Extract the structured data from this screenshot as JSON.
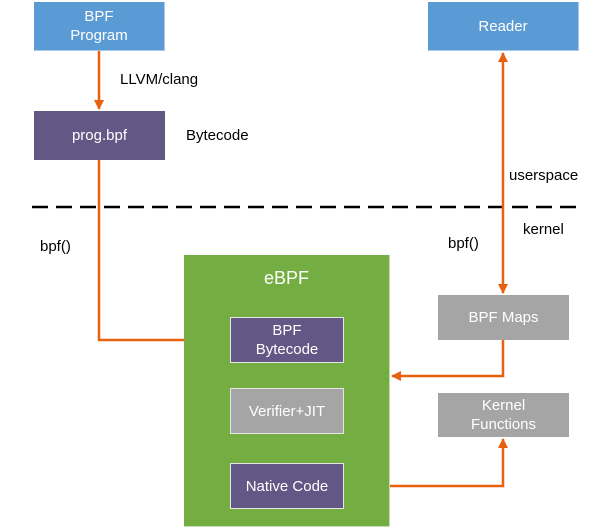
{
  "diagram": {
    "colors": {
      "userspace_box": "#5b9bd5",
      "bytecode_box": "#625785",
      "kernel_box": "#a5a5a5",
      "ebpf_container": "#74ae43",
      "arrow": "#e8610f",
      "divider": "#000000"
    },
    "nodes": {
      "bpf_program": "BPF\nProgram",
      "prog_bpf": "prog.bpf",
      "reader": "Reader",
      "ebpf": "eBPF",
      "bpf_bytecode": "BPF\nBytecode",
      "verifier_jit": "Verifier+JIT",
      "native_code": "Native Code",
      "bpf_maps": "BPF Maps",
      "kernel_functions": "Kernel\nFunctions"
    },
    "labels": {
      "llvm_clang": "LLVM/clang",
      "bytecode": "Bytecode",
      "userspace": "userspace",
      "kernel": "kernel",
      "bpf_call_left": "bpf()",
      "bpf_call_right": "bpf()"
    },
    "edges": [
      {
        "from": "BPF Program",
        "to": "prog.bpf",
        "label": "LLVM/clang"
      },
      {
        "from": "prog.bpf",
        "to": "BPF Bytecode",
        "label": "bpf()"
      },
      {
        "from": "BPF Bytecode",
        "to": "Verifier+JIT"
      },
      {
        "from": "Verifier+JIT",
        "to": "Native Code"
      },
      {
        "from": "Native Code",
        "to": "Kernel Functions"
      },
      {
        "from": "BPF Maps",
        "to": "eBPF"
      },
      {
        "from": "Reader",
        "to": "BPF Maps",
        "label": "bpf()",
        "bidirectional": true
      }
    ]
  }
}
